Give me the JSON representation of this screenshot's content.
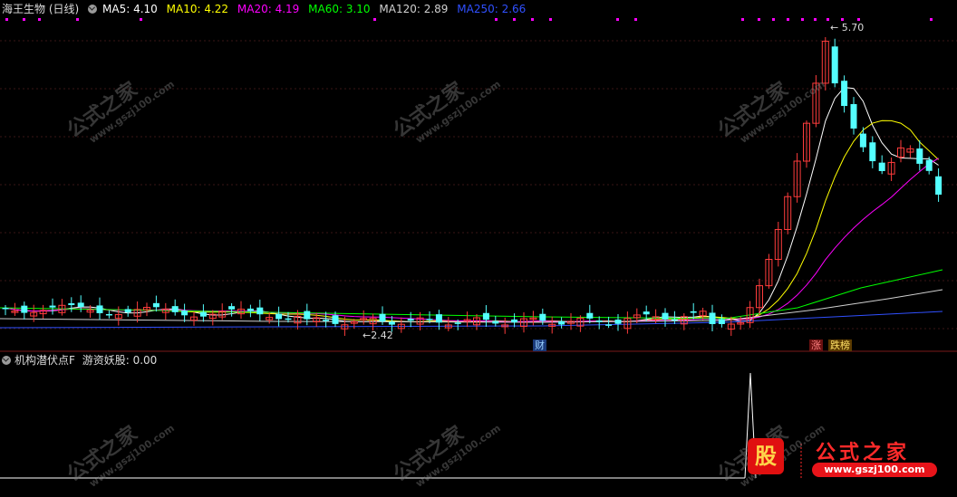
{
  "header": {
    "stock": "海王生物 (日线)",
    "ma": [
      {
        "label": "MA5: 4.10",
        "color": "#ffffff"
      },
      {
        "label": "MA10: 4.22",
        "color": "#ffff00"
      },
      {
        "label": "MA20: 4.19",
        "color": "#ff00ff"
      },
      {
        "label": "MA60: 3.10",
        "color": "#00ff00"
      },
      {
        "label": "MA120: 2.89",
        "color": "#d0d0d0"
      },
      {
        "label": "MA250: 2.66",
        "color": "#3050ff"
      }
    ]
  },
  "annotations": {
    "high": "5.70",
    "low": "2.42",
    "tag_cai": "财",
    "tag_zhang": "涨",
    "tag_diebang": "跌榜"
  },
  "sub_header": {
    "indicator": "机构潜伏点F",
    "value": "游资妖股: 0.00"
  },
  "watermark": {
    "text": "公式之家",
    "url": "www.gszj100.com"
  },
  "logo": {
    "badge": "股",
    "text": "公式之家",
    "url": "www.gszj100.com"
  },
  "colors": {
    "up": "#ff3c3c",
    "down": "#54ffff",
    "ma5": "#ffffff",
    "ma10": "#ffff00",
    "ma20": "#ff00ff",
    "ma60": "#00ff00",
    "ma120": "#d0d0d0",
    "ma250": "#3050ff",
    "dots": "#ff00ff"
  }
}
